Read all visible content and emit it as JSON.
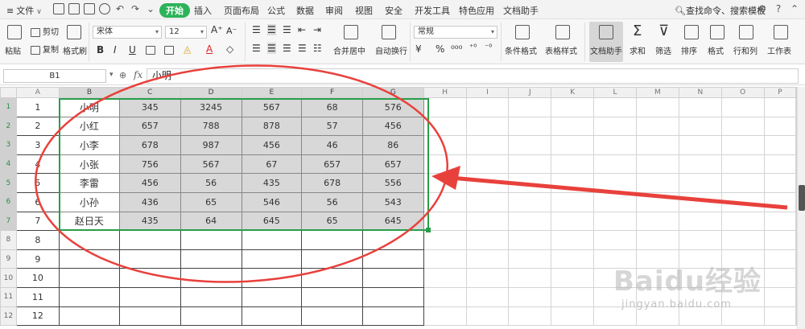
{
  "menubar": {
    "file_label": "文件",
    "tabs": [
      "开始",
      "插入",
      "页面布局",
      "公式",
      "数据",
      "审阅",
      "视图",
      "安全",
      "开发工具",
      "特色应用",
      "文档助手"
    ],
    "active_tab": "开始",
    "search_label": "查找命令、搜索模板"
  },
  "ribbon": {
    "paste": "粘贴",
    "cut": "剪切",
    "copy": "复制",
    "format_painter": "格式刷",
    "font_name": "宋体",
    "font_size": "12",
    "number_format": "常规",
    "merge_center": "合并居中",
    "wrap_text": "自动换行",
    "conditional_format": "条件格式",
    "table_style": "表格样式",
    "doc_helper": "文档助手",
    "sum": "求和",
    "filter": "筛选",
    "sort": "排序",
    "format": "格式",
    "row_col": "行和列",
    "worksheet": "工作表"
  },
  "formula_bar": {
    "cell_ref": "B1",
    "fx_label": "fx",
    "value": "小明"
  },
  "sheet": {
    "columns": [
      "A",
      "B",
      "C",
      "D",
      "E",
      "F",
      "G",
      "H",
      "I",
      "J",
      "K",
      "L",
      "M",
      "N",
      "O",
      "P"
    ],
    "rows": [
      {
        "num": "1",
        "a": "1",
        "cells": [
          "小明",
          "345",
          "3245",
          "567",
          "68",
          "576"
        ]
      },
      {
        "num": "2",
        "a": "2",
        "cells": [
          "小红",
          "657",
          "788",
          "878",
          "57",
          "456"
        ]
      },
      {
        "num": "3",
        "a": "3",
        "cells": [
          "小李",
          "678",
          "987",
          "456",
          "46",
          "86"
        ]
      },
      {
        "num": "4",
        "a": "4",
        "cells": [
          "小张",
          "756",
          "567",
          "67",
          "657",
          "657"
        ]
      },
      {
        "num": "5",
        "a": "5",
        "cells": [
          "李雷",
          "456",
          "56",
          "435",
          "678",
          "556"
        ]
      },
      {
        "num": "6",
        "a": "6",
        "cells": [
          "小孙",
          "436",
          "65",
          "546",
          "56",
          "543"
        ]
      },
      {
        "num": "7",
        "a": "7",
        "cells": [
          "赵日天",
          "435",
          "64",
          "645",
          "65",
          "645"
        ]
      },
      {
        "num": "8",
        "a": "8",
        "cells": [
          "",
          "",
          "",
          "",
          "",
          ""
        ]
      },
      {
        "num": "9",
        "a": "9",
        "cells": [
          "",
          "",
          "",
          "",
          "",
          ""
        ]
      },
      {
        "num": "10",
        "a": "10",
        "cells": [
          "",
          "",
          "",
          "",
          "",
          ""
        ]
      },
      {
        "num": "11",
        "a": "11",
        "cells": [
          "",
          "",
          "",
          "",
          "",
          ""
        ]
      },
      {
        "num": "12",
        "a": "12",
        "cells": [
          "",
          "",
          "",
          "",
          "",
          ""
        ]
      }
    ]
  },
  "annotation": {
    "ellipse_color": "#e8413c",
    "arrow_color": "#e8413c"
  },
  "watermark": {
    "brand": "Baidu经验",
    "url": "jingyan.baidu.com"
  },
  "colors": {
    "accent_green": "#2cb35a",
    "selection_green": "#2a9e4a"
  }
}
